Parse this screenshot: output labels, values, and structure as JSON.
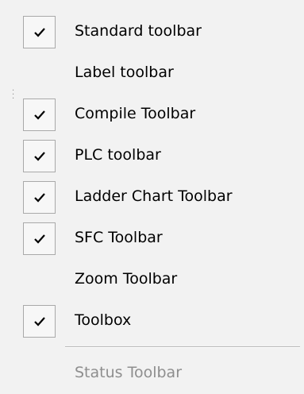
{
  "menu": {
    "items": [
      {
        "label": "Standard toolbar",
        "checked": true,
        "enabled": true,
        "icon": "check-icon"
      },
      {
        "label": "Label toolbar",
        "checked": false,
        "enabled": true
      },
      {
        "label": "Compile Toolbar",
        "checked": true,
        "enabled": true,
        "icon": "check-icon"
      },
      {
        "label": "PLC toolbar",
        "checked": true,
        "enabled": true,
        "icon": "check-icon"
      },
      {
        "label": "Ladder Chart Toolbar",
        "checked": true,
        "enabled": true,
        "icon": "check-icon"
      },
      {
        "label": "SFC Toolbar",
        "checked": true,
        "enabled": true,
        "icon": "check-icon"
      },
      {
        "label": "Zoom Toolbar",
        "checked": false,
        "enabled": true
      },
      {
        "label": "Toolbox",
        "checked": true,
        "enabled": true,
        "icon": "check-icon"
      }
    ],
    "disabled_item": {
      "label": "Status Toolbar",
      "enabled": false
    },
    "colors": {
      "background": "#f2f2f2",
      "text": "#000000",
      "disabled_text": "#8e8e8e",
      "check_border": "#a9a9a9"
    }
  }
}
